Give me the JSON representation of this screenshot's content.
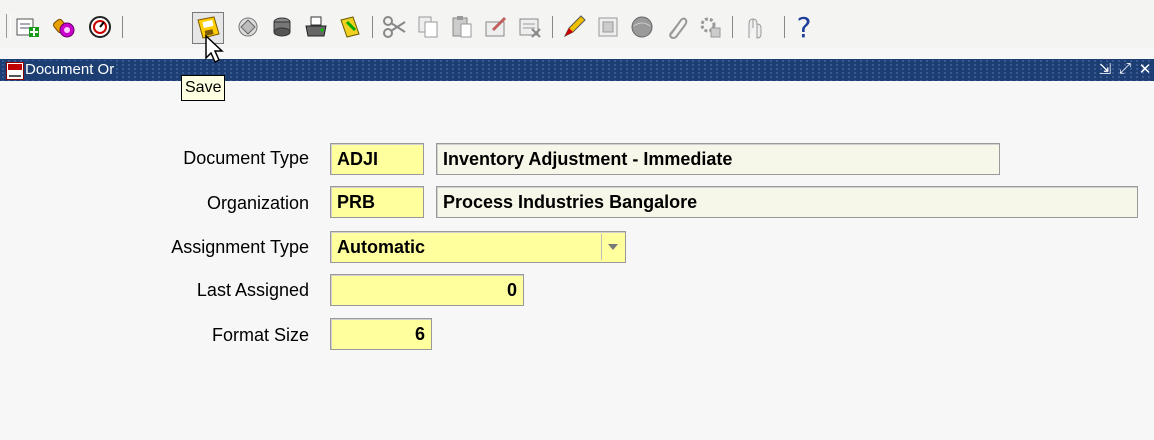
{
  "toolbar": {
    "icons": [
      "new-icon",
      "find-icon",
      "navigator-icon",
      "save-icon",
      "next-step-icon",
      "switch-responsibility-icon",
      "print-icon",
      "close-form-icon",
      "cut-icon",
      "copy-icon",
      "paste-icon",
      "new-record-icon",
      "delete-record-icon",
      "edit-field-icon",
      "zoom-icon",
      "translations-icon",
      "attachments-icon",
      "folder-tools-icon",
      "window-help-icon",
      "help-icon"
    ],
    "help_label": "?"
  },
  "tooltip": {
    "text": "Save"
  },
  "window": {
    "title": "Document Or",
    "controls": {
      "minimize": "⇲",
      "maximize": "⤢",
      "close": "✕"
    }
  },
  "form": {
    "document_type": {
      "label": "Document Type",
      "code": "ADJI",
      "description": "Inventory Adjustment - Immediate"
    },
    "organization": {
      "label": "Organization",
      "code": "PRB",
      "description": "Process Industries Bangalore"
    },
    "assignment_type": {
      "label": "Assignment Type",
      "value": "Automatic"
    },
    "last_assigned": {
      "label": "Last Assigned",
      "value": "0"
    },
    "format_size": {
      "label": "Format Size",
      "value": "6"
    }
  },
  "colors": {
    "titlebar": "#1c3e73",
    "required_field": "#ffff9e",
    "readonly_field": "#f7f7e9",
    "tooltip": "#ffffe1"
  }
}
